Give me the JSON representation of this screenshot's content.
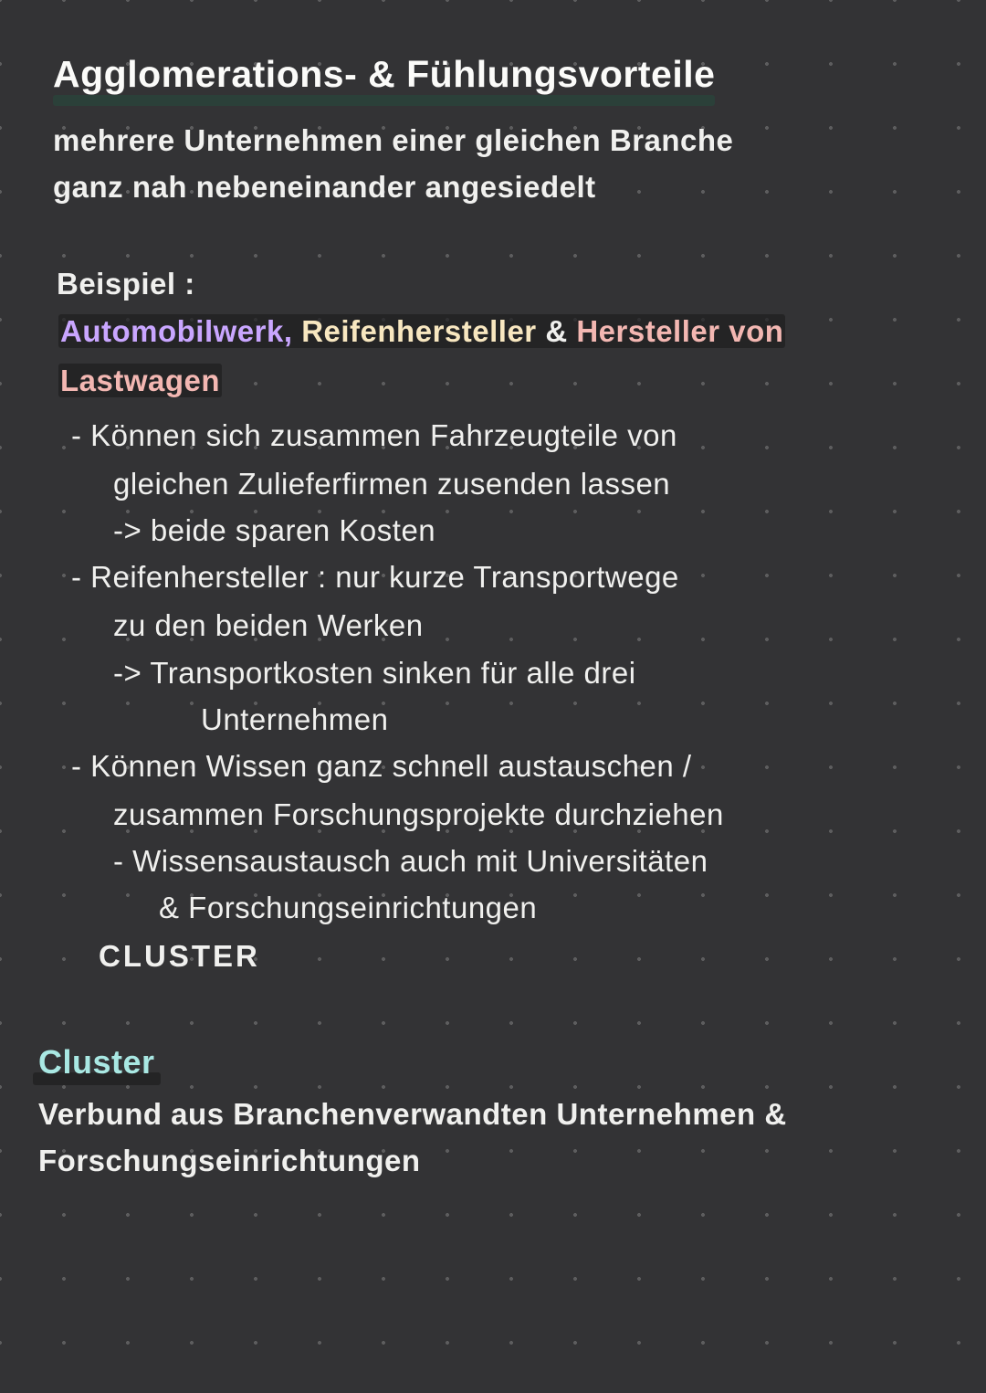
{
  "title": "Agglomerations- & Fühlungsvorteile",
  "subtitle_line1": "mehrere Unternehmen einer gleichen Branche",
  "subtitle_line2": "ganz nah nebeneinander angesiedelt",
  "example": {
    "label": "Beispiel :",
    "part1": "Automobilwerk,",
    "part2": "Reifenhersteller",
    "amp": "&",
    "part3a": "Hersteller von",
    "part3b": "Lastwagen"
  },
  "bullets": {
    "b1_l1": "- Können sich zusammen Fahrzeugteile von",
    "b1_l2": "gleichen Zulieferfirmen zusenden lassen",
    "b1_arrow": "-> beide sparen Kosten",
    "b2_l1": "- Reifenhersteller : nur kurze Transportwege",
    "b2_l2": "zu den beiden Werken",
    "b2_arrow1": "-> Transportkosten sinken für alle drei",
    "b2_arrow2": "Unternehmen",
    "b3_l1": "- Können Wissen ganz schnell austauschen /",
    "b3_l2": "zusammen Forschungsprojekte durchziehen",
    "b3_sub1": "- Wissensaustausch auch mit Universitäten",
    "b3_sub2": "& Forschungseinrichtungen",
    "cluster_word": "CLUSTER"
  },
  "cluster": {
    "heading": "Cluster",
    "def_line1": "Verbund aus Branchenverwandten Unternehmen &",
    "def_line2": "Forschungseinrichtungen"
  }
}
